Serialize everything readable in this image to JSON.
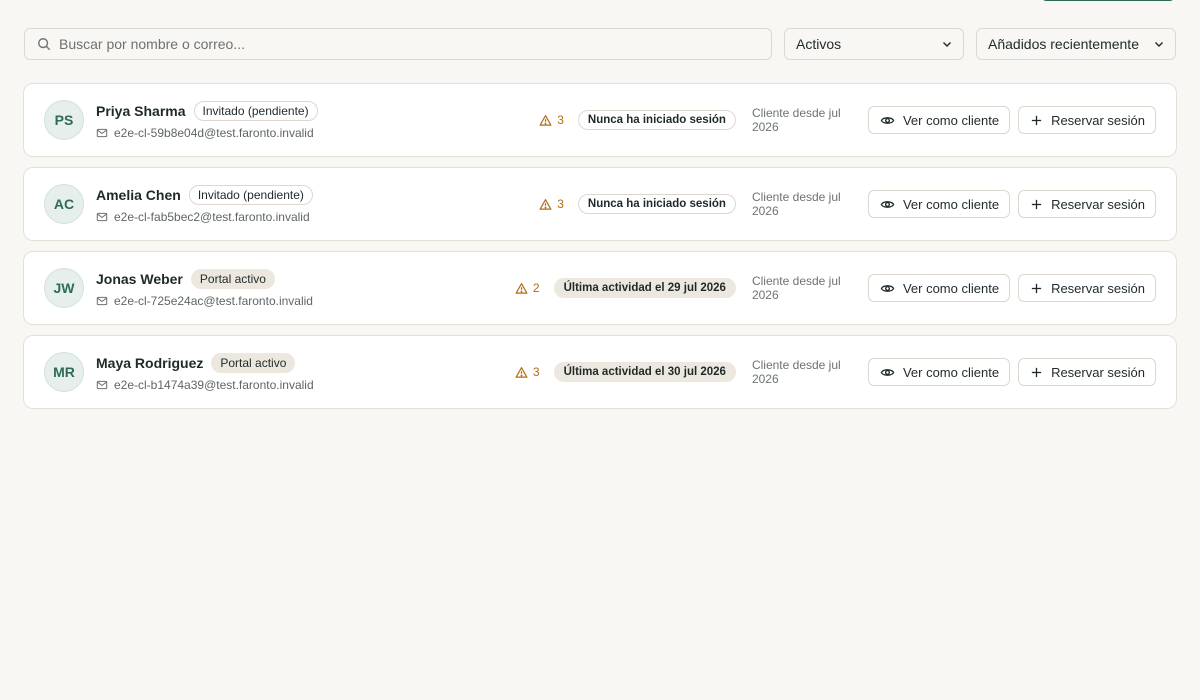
{
  "filters": {
    "search_placeholder": "Buscar por nombre o correo...",
    "status_value": "Activos",
    "sort_value": "Añadidos recientemente"
  },
  "clients": [
    {
      "initials": "PS",
      "name": "Priya Sharma",
      "status": "Invitado (pendiente)",
      "status_type": "invited",
      "email": "e2e-cl-59b8e04d@test.faronto.invalid",
      "warnings": "3",
      "activity": "Nunca ha iniciado sesión",
      "activity_type": "never",
      "since": "Cliente desde jul 2026"
    },
    {
      "initials": "AC",
      "name": "Amelia Chen",
      "status": "Invitado (pendiente)",
      "status_type": "invited",
      "email": "e2e-cl-fab5bec2@test.faronto.invalid",
      "warnings": "3",
      "activity": "Nunca ha iniciado sesión",
      "activity_type": "never",
      "since": "Cliente desde jul 2026"
    },
    {
      "initials": "JW",
      "name": "Jonas Weber",
      "status": "Portal activo",
      "status_type": "active",
      "email": "e2e-cl-725e24ac@test.faronto.invalid",
      "warnings": "2",
      "activity": "Última actividad el 29 jul 2026",
      "activity_type": "last",
      "since": "Cliente desde jul 2026"
    },
    {
      "initials": "MR",
      "name": "Maya Rodriguez",
      "status": "Portal activo",
      "status_type": "active",
      "email": "e2e-cl-b1474a39@test.faronto.invalid",
      "warnings": "3",
      "activity": "Última actividad el 30 jul 2026",
      "activity_type": "last",
      "since": "Cliente desde jul 2026"
    }
  ],
  "actions": {
    "view_label": "Ver como cliente",
    "book_label": "Reservar sesión"
  },
  "colors": {
    "accent": "#2f6b57",
    "warning": "#b26b16",
    "background": "#f9f7f3"
  }
}
